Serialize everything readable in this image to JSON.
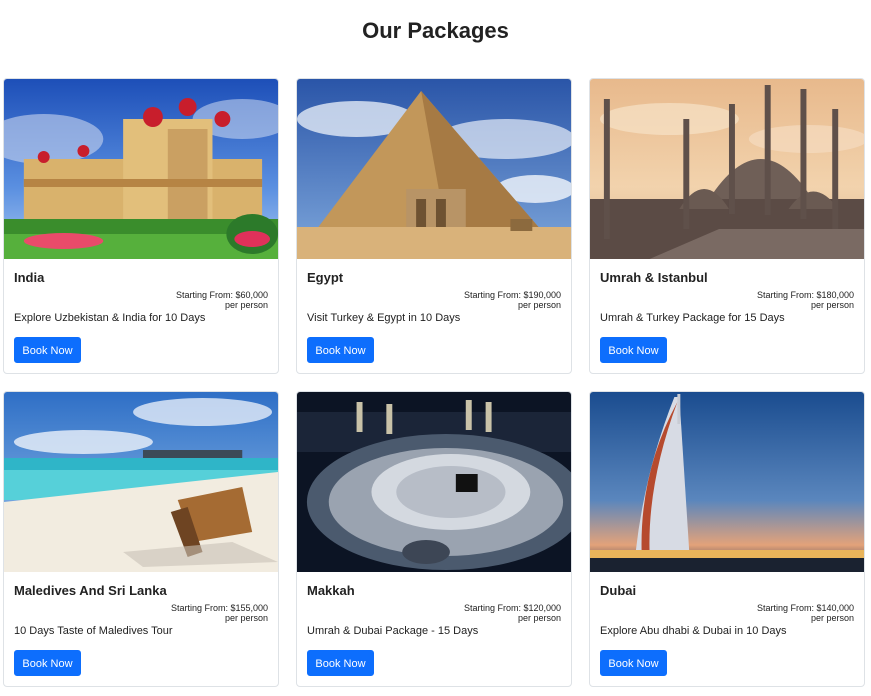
{
  "page": {
    "title": "Our Packages"
  },
  "packages": [
    {
      "title": "India",
      "price_prefix": "Starting From: ",
      "price": "$60,000",
      "per": "per person",
      "description": "Explore Uzbekistan & India for 10 Days",
      "button": "Book Now"
    },
    {
      "title": "Egypt",
      "price_prefix": "Starting From: ",
      "price": "$190,000",
      "per": "per person",
      "description": "Visit Turkey & Egypt in 10 Days",
      "button": "Book Now"
    },
    {
      "title": "Umrah & Istanbul",
      "price_prefix": "Starting From: ",
      "price": "$180,000",
      "per": "per person",
      "description": "Umrah & Turkey Package for 15 Days",
      "button": "Book Now"
    },
    {
      "title": "Maledives And Sri Lanka",
      "price_prefix": "Starting From: ",
      "price": "$155,000",
      "per": "per person",
      "description": "10 Days Taste of Maledives Tour",
      "button": "Book Now"
    },
    {
      "title": "Makkah",
      "price_prefix": "Starting From: ",
      "price": "$120,000",
      "per": "per person",
      "description": "Umrah & Dubai Package - 15 Days",
      "button": "Book Now"
    },
    {
      "title": "Dubai",
      "price_prefix": "Starting From: ",
      "price": "$140,000",
      "per": "per person",
      "description": "Explore Abu dhabi & Dubai in 10 Days",
      "button": "Book Now"
    }
  ],
  "colors": {
    "button": "#0d6efd",
    "border": "#dee2e6"
  }
}
